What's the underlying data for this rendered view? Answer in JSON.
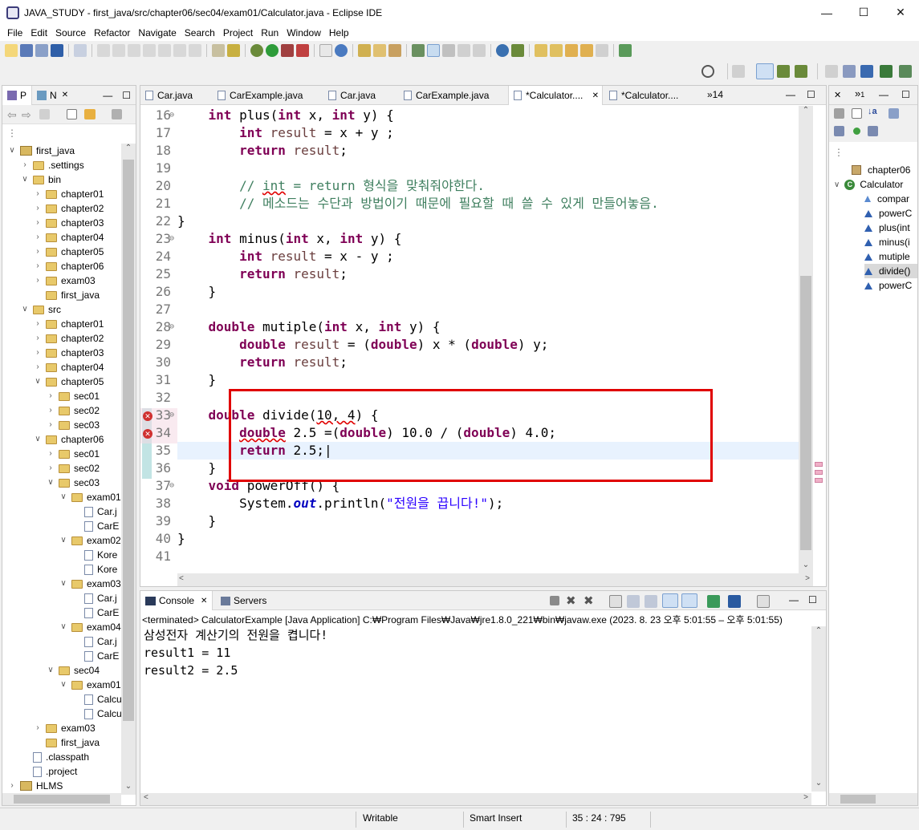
{
  "window": {
    "title": "JAVA_STUDY - first_java/src/chapter06/sec04/exam01/Calculator.java - Eclipse IDE"
  },
  "menu": [
    "File",
    "Edit",
    "Source",
    "Refactor",
    "Navigate",
    "Search",
    "Project",
    "Run",
    "Window",
    "Help"
  ],
  "left_panel": {
    "tabs": [
      "P",
      "N"
    ],
    "tree": [
      {
        "label": "first_java",
        "indent": 0,
        "type": "project",
        "open": true
      },
      {
        "label": ".settings",
        "indent": 1,
        "type": "folder",
        "open": false
      },
      {
        "label": "bin",
        "indent": 1,
        "type": "folder",
        "open": true
      },
      {
        "label": "chapter01",
        "indent": 2,
        "type": "folder",
        "open": false
      },
      {
        "label": "chapter02",
        "indent": 2,
        "type": "folder",
        "open": false
      },
      {
        "label": "chapter03",
        "indent": 2,
        "type": "folder",
        "open": false
      },
      {
        "label": "chapter04",
        "indent": 2,
        "type": "folder",
        "open": false
      },
      {
        "label": "chapter05",
        "indent": 2,
        "type": "folder",
        "open": false
      },
      {
        "label": "chapter06",
        "indent": 2,
        "type": "folder",
        "open": false
      },
      {
        "label": "exam03",
        "indent": 2,
        "type": "folder",
        "open": false
      },
      {
        "label": "first_java",
        "indent": 2,
        "type": "folder",
        "open": null
      },
      {
        "label": "src",
        "indent": 1,
        "type": "folder",
        "open": true
      },
      {
        "label": "chapter01",
        "indent": 2,
        "type": "folder",
        "open": false
      },
      {
        "label": "chapter02",
        "indent": 2,
        "type": "folder",
        "open": false
      },
      {
        "label": "chapter03",
        "indent": 2,
        "type": "folder",
        "open": false
      },
      {
        "label": "chapter04",
        "indent": 2,
        "type": "folder",
        "open": false
      },
      {
        "label": "chapter05",
        "indent": 2,
        "type": "folder",
        "open": true
      },
      {
        "label": "sec01",
        "indent": 3,
        "type": "folder",
        "open": false
      },
      {
        "label": "sec02",
        "indent": 3,
        "type": "folder",
        "open": false
      },
      {
        "label": "sec03",
        "indent": 3,
        "type": "folder",
        "open": false
      },
      {
        "label": "chapter06",
        "indent": 2,
        "type": "folder",
        "open": true
      },
      {
        "label": "sec01",
        "indent": 3,
        "type": "folder",
        "open": false
      },
      {
        "label": "sec02",
        "indent": 3,
        "type": "folder",
        "open": false
      },
      {
        "label": "sec03",
        "indent": 3,
        "type": "folder",
        "open": true
      },
      {
        "label": "exam01",
        "indent": 4,
        "type": "folder",
        "open": true
      },
      {
        "label": "Car.j",
        "indent": 5,
        "type": "file",
        "open": null
      },
      {
        "label": "CarE",
        "indent": 5,
        "type": "file",
        "open": null
      },
      {
        "label": "exam02",
        "indent": 4,
        "type": "folder",
        "open": true
      },
      {
        "label": "Kore",
        "indent": 5,
        "type": "file",
        "open": null
      },
      {
        "label": "Kore",
        "indent": 5,
        "type": "file",
        "open": null
      },
      {
        "label": "exam03",
        "indent": 4,
        "type": "folder",
        "open": true
      },
      {
        "label": "Car.j",
        "indent": 5,
        "type": "file",
        "open": null
      },
      {
        "label": "CarE",
        "indent": 5,
        "type": "file",
        "open": null
      },
      {
        "label": "exam04",
        "indent": 4,
        "type": "folder",
        "open": true
      },
      {
        "label": "Car.j",
        "indent": 5,
        "type": "file",
        "open": null
      },
      {
        "label": "CarE",
        "indent": 5,
        "type": "file",
        "open": null
      },
      {
        "label": "sec04",
        "indent": 3,
        "type": "folder",
        "open": true
      },
      {
        "label": "exam01",
        "indent": 4,
        "type": "folder",
        "open": true
      },
      {
        "label": "Calcu",
        "indent": 5,
        "type": "file",
        "open": null
      },
      {
        "label": "Calcu",
        "indent": 5,
        "type": "file",
        "open": null
      },
      {
        "label": "exam03",
        "indent": 2,
        "type": "folder",
        "open": false
      },
      {
        "label": "first_java",
        "indent": 2,
        "type": "folder",
        "open": null
      },
      {
        "label": ".classpath",
        "indent": 1,
        "type": "file",
        "open": null
      },
      {
        "label": ".project",
        "indent": 1,
        "type": "file",
        "open": null
      },
      {
        "label": "HLMS",
        "indent": 0,
        "type": "project",
        "open": false
      }
    ]
  },
  "editor": {
    "tabs": [
      "Car.java",
      "CarExample.java",
      "Car.java",
      "CarExample.java",
      "*Calculator....",
      "*Calculator...."
    ],
    "overflow": "»14",
    "lines": [
      {
        "n": "16",
        "html": "    <span class=\"kw\">int</span> plus(<span class=\"kw\">int</span> x, <span class=\"kw\">int</span> y) {"
      },
      {
        "n": "17",
        "html": "        <span class=\"kw\">int</span> <span class=\"var\">result</span> = x + y ;"
      },
      {
        "n": "18",
        "html": "        <span class=\"kw\">return</span> <span class=\"var\">result</span>;"
      },
      {
        "n": "19",
        "html": ""
      },
      {
        "n": "20",
        "html": "        <span class=\"cm\">// <span class=\"err\">int</span> = return 형식을 맞춰줘야한다.</span>"
      },
      {
        "n": "21",
        "html": "        <span class=\"cm\">// 메소드는 수단과 방법이기 때문에 필요할 때 쓸 수 있게 만들어놓음.</span>"
      },
      {
        "n": "22",
        "html": "}"
      },
      {
        "n": "23",
        "html": "    <span class=\"kw\">int</span> minus(<span class=\"kw\">int</span> x, <span class=\"kw\">int</span> y) {"
      },
      {
        "n": "24",
        "html": "        <span class=\"kw\">int</span> <span class=\"var\">result</span> = x - y ;"
      },
      {
        "n": "25",
        "html": "        <span class=\"kw\">return</span> <span class=\"var\">result</span>;"
      },
      {
        "n": "26",
        "html": "    }"
      },
      {
        "n": "27",
        "html": ""
      },
      {
        "n": "28",
        "html": "    <span class=\"kw\">double</span> mutiple(<span class=\"kw\">int</span> x, <span class=\"kw\">int</span> y) {"
      },
      {
        "n": "29",
        "html": "        <span class=\"kw\">double</span> <span class=\"var\">result</span> = (<span class=\"kw\">double</span>) x * (<span class=\"kw\">double</span>) y;"
      },
      {
        "n": "30",
        "html": "        <span class=\"kw\">return</span> <span class=\"var\">result</span>;"
      },
      {
        "n": "31",
        "html": "    }"
      },
      {
        "n": "32",
        "html": ""
      },
      {
        "n": "33",
        "html": "    <span class=\"kw\">double</span> divide(<span class=\"err\">10, 4</span>) {"
      },
      {
        "n": "34",
        "html": "        <span class=\"kw err\">double</span> 2.5 =(<span class=\"kw\">double</span>) 10.0 / (<span class=\"kw\">double</span>) 4.0;"
      },
      {
        "n": "35",
        "html": "        <span class=\"kw\">return</span> 2.5;|"
      },
      {
        "n": "36",
        "html": "    }"
      },
      {
        "n": "37",
        "html": "    <span class=\"kw\">void</span> powerOff() {"
      },
      {
        "n": "38",
        "html": "        System.<span class=\"fld\">out</span>.println(<span class=\"str\">\"전원을 끕니다!\"</span>);"
      },
      {
        "n": "39",
        "html": "    }"
      },
      {
        "n": "40",
        "html": "}"
      },
      {
        "n": "41",
        "html": ""
      }
    ]
  },
  "outline": {
    "items": [
      {
        "label": "chapter06",
        "indent": 1
      },
      {
        "label": "Calculator",
        "indent": 0
      },
      {
        "label": "compar",
        "indent": 2
      },
      {
        "label": "powerC",
        "indent": 2
      },
      {
        "label": "plus(int",
        "indent": 2
      },
      {
        "label": "minus(i",
        "indent": 2
      },
      {
        "label": "mutiple",
        "indent": 2
      },
      {
        "label": "divide()",
        "indent": 2
      },
      {
        "label": "powerC",
        "indent": 2
      }
    ]
  },
  "console": {
    "tabs": [
      "Console",
      "Servers"
    ],
    "status": "<terminated> CalculatorExample [Java Application] C:₩Program Files₩Java₩jre1.8.0_221₩bin₩javaw.exe  (2023. 8. 23 오후 5:01:55 – 오후 5:01:55)",
    "output": [
      "삼성전자 계산기의 전원을 켭니다!",
      "result1 = 11",
      "result2 = 2.5"
    ]
  },
  "statusbar": {
    "writable": "Writable",
    "insert": "Smart Insert",
    "position": "35 : 24 : 795"
  },
  "colors": {
    "keyword": "#7f0055",
    "comment": "#3f7f5f",
    "string": "#2a00ff",
    "highlight_box": "#e00000",
    "current_line": "#e8f2fe"
  }
}
